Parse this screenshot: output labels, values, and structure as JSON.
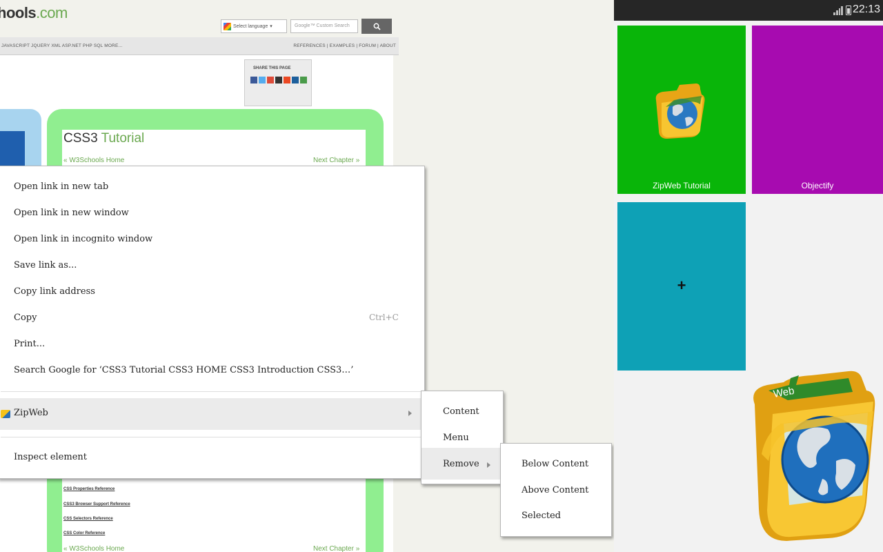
{
  "browser": {
    "logo": {
      "prefix": "hools",
      "suffix": ".com"
    },
    "search": {
      "language_label": "Select language",
      "google_placeholder": "Google™ Custom Search",
      "button_icon": "search-icon"
    },
    "topnav": {
      "left_items": "JAVASCRIPT  JQUERY  XML  ASP.NET  PHP  SQL  MORE...",
      "right_items": "REFERENCES  |  EXAMPLES  |  FORUM  |  ABOUT"
    },
    "share": {
      "label": "SHARE THIS PAGE"
    },
    "page": {
      "title_part1": "CSS3",
      "title_part2": "Tutorial",
      "prev_link": "« W3Schools Home",
      "next_link": "Next Chapter »",
      "references": [
        "CSS Properties Reference",
        "CSS3 Browser Support Reference",
        "CSS Selectors Reference",
        "CSS Color Reference"
      ],
      "prev_link_bottom": "« W3Schools Home",
      "next_link_bottom": "Next Chapter »"
    }
  },
  "context_menu": {
    "items": [
      "Open link in new tab",
      "Open link in new window",
      "Open link in incognito window",
      "Save link as...",
      "Copy link address",
      "Copy",
      "Print...",
      "Search Google for ‘CSS3 Tutorial CSS3 HOME CSS3 Introduction CSS3…’"
    ],
    "copy_shortcut": "Ctrl+C",
    "zipweb": "ZipWeb",
    "inspect": "Inspect element"
  },
  "zipweb_submenu": {
    "items": [
      "Content",
      "Menu",
      "Remove"
    ]
  },
  "remove_submenu": {
    "items": [
      "Below Content",
      "Above Content",
      "Selected"
    ]
  },
  "android": {
    "status": {
      "time": "22:13"
    },
    "tiles": [
      {
        "label": "ZipWeb Tutorial",
        "color": "#09b509",
        "icon": "zipweb-folder-icon"
      },
      {
        "label": "Objectify",
        "color": "#a70bb0"
      },
      {
        "label": "",
        "color": "#0ea1b6",
        "icon": "plus-icon"
      }
    ],
    "logo_text": "Web"
  }
}
